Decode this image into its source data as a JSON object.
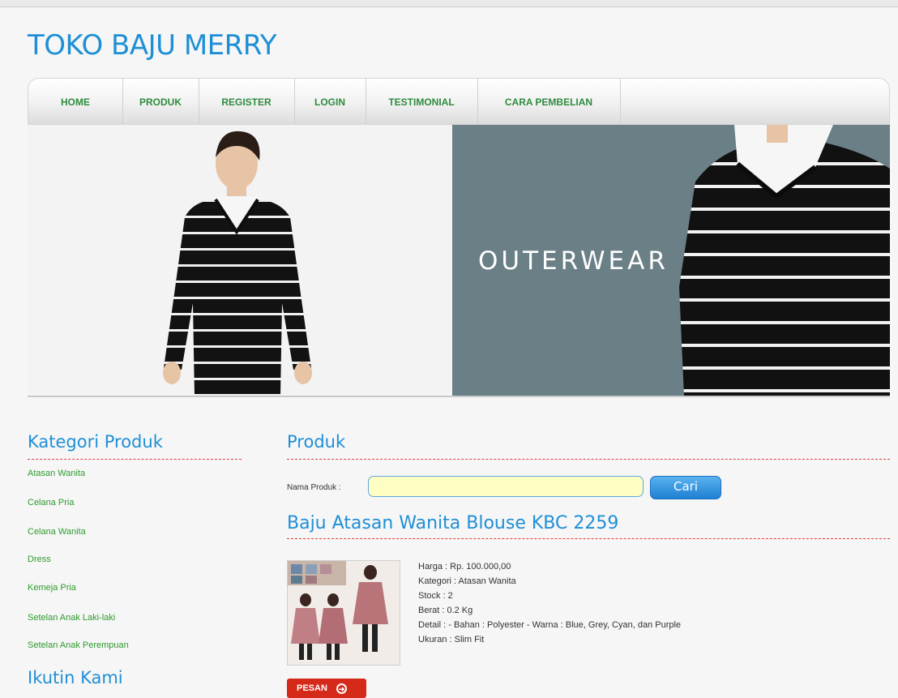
{
  "site": {
    "title": "TOKO BAJU MERRY"
  },
  "nav": {
    "items": [
      {
        "label": "HOME"
      },
      {
        "label": "PRODUK"
      },
      {
        "label": "REGISTER"
      },
      {
        "label": "LOGIN"
      },
      {
        "label": "TESTIMONIAL"
      },
      {
        "label": "CARA PEMBELIAN"
      }
    ]
  },
  "banner": {
    "text": "OUTERWEAR"
  },
  "sidebar": {
    "heading": "Kategori Produk",
    "categories": [
      {
        "label": "Atasan Wanita"
      },
      {
        "label": "Celana Pria"
      },
      {
        "label": "Celana Wanita"
      },
      {
        "label": "Dress"
      },
      {
        "label": "Kemeja Pria"
      },
      {
        "label": "Setelan Anak Laki-laki"
      },
      {
        "label": "Setelan Anak Perempuan"
      }
    ],
    "follow_heading": "Ikutin Kami"
  },
  "main": {
    "heading": "Produk",
    "search": {
      "label": "Nama Produk :",
      "value": "",
      "button": "Cari"
    },
    "product": {
      "title": "Baju Atasan Wanita Blouse KBC 2259",
      "details": [
        "Harga : Rp. 100.000,00",
        "Kategori : Atasan Wanita",
        "Stock : 2",
        "Berat : 0.2 Kg",
        "Detail : - Bahan : Polyester - Warna : Blue, Grey, Cyan, dan Purple",
        "Ukuran : Slim Fit"
      ],
      "order_button": "PESAN"
    }
  },
  "colors": {
    "accent": "#1e8fd6",
    "nav_text": "#2e8b3e",
    "divider": "#e33b3b",
    "order": "#d52a1a"
  }
}
